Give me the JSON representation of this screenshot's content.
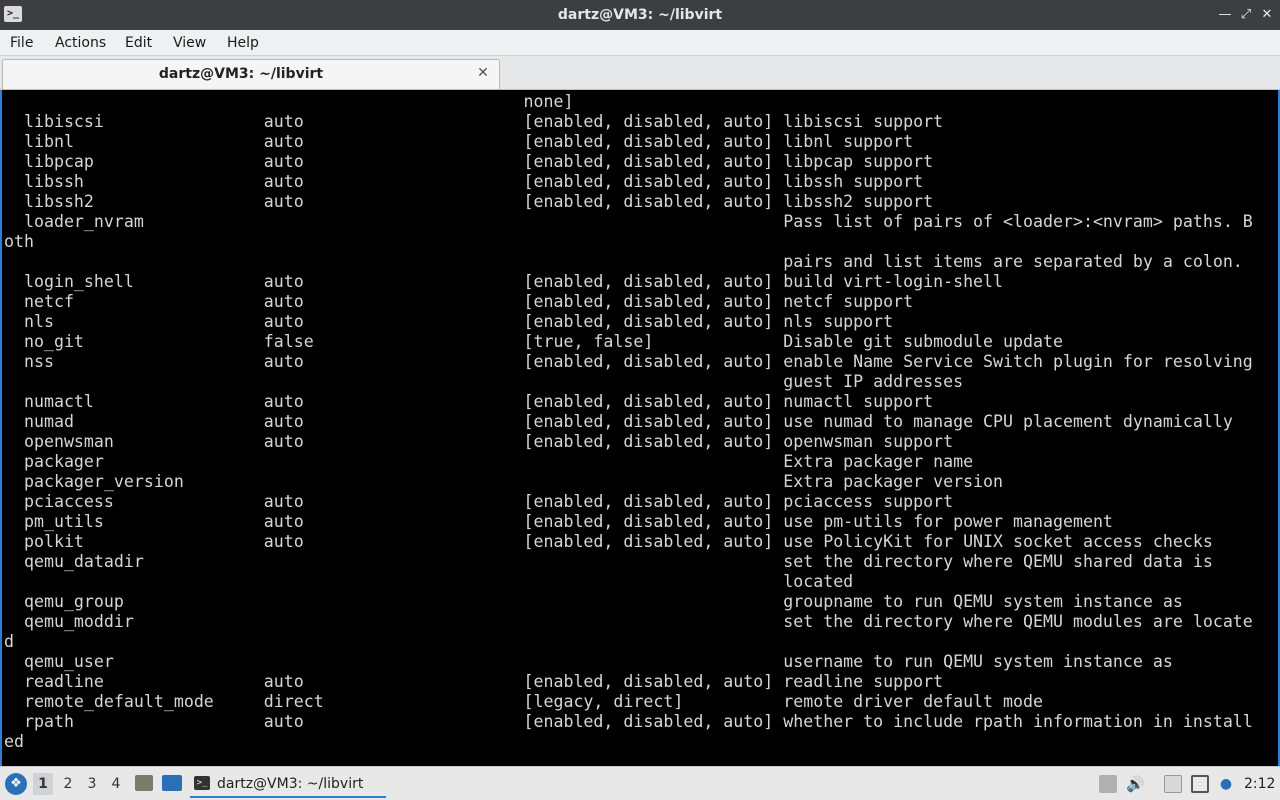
{
  "window": {
    "title": "dartz@VM3: ~/libvirt",
    "app_icon": "terminal-icon",
    "controls": {
      "minimize": "minimize-icon",
      "maximize": "maximize-icon",
      "close": "close-icon"
    }
  },
  "menubar": {
    "items": [
      "File",
      "Actions",
      "Edit",
      "View",
      "Help"
    ]
  },
  "tabs": [
    {
      "label": "dartz@VM3: ~/libvirt",
      "close_icon": "close-icon"
    }
  ],
  "terminal": {
    "lines": [
      "                                                    none]",
      "  libiscsi                auto                      [enabled, disabled, auto] libiscsi support",
      "  libnl                   auto                      [enabled, disabled, auto] libnl support",
      "  libpcap                 auto                      [enabled, disabled, auto] libpcap support",
      "  libssh                  auto                      [enabled, disabled, auto] libssh support",
      "  libssh2                 auto                      [enabled, disabled, auto] libssh2 support",
      "  loader_nvram                                                                Pass list of pairs of <loader>:<nvram> paths. B",
      "oth",
      "                                                                              pairs and list items are separated by a colon.",
      "  login_shell             auto                      [enabled, disabled, auto] build virt-login-shell",
      "  netcf                   auto                      [enabled, disabled, auto] netcf support",
      "  nls                     auto                      [enabled, disabled, auto] nls support",
      "  no_git                  false                     [true, false]             Disable git submodule update",
      "  nss                     auto                      [enabled, disabled, auto] enable Name Service Switch plugin for resolving",
      "                                                                              guest IP addresses",
      "  numactl                 auto                      [enabled, disabled, auto] numactl support",
      "  numad                   auto                      [enabled, disabled, auto] use numad to manage CPU placement dynamically",
      "  openwsman               auto                      [enabled, disabled, auto] openwsman support",
      "  packager                                                                    Extra packager name",
      "  packager_version                                                            Extra packager version",
      "  pciaccess               auto                      [enabled, disabled, auto] pciaccess support",
      "  pm_utils                auto                      [enabled, disabled, auto] use pm-utils for power management",
      "  polkit                  auto                      [enabled, disabled, auto] use PolicyKit for UNIX socket access checks",
      "  qemu_datadir                                                                set the directory where QEMU shared data is",
      "                                                                              located",
      "  qemu_group                                                                  groupname to run QEMU system instance as",
      "  qemu_moddir                                                                 set the directory where QEMU modules are locate",
      "d",
      "  qemu_user                                                                   username to run QEMU system instance as",
      "  readline                auto                      [enabled, disabled, auto] readline support",
      "  remote_default_mode     direct                    [legacy, direct]          remote driver default mode",
      "  rpath                   auto                      [enabled, disabled, auto] whether to include rpath information in install",
      "ed"
    ]
  },
  "taskbar": {
    "start_icon": "start-menu-icon",
    "workspaces": [
      "1",
      "2",
      "3",
      "4"
    ],
    "active_workspace": "1",
    "launchers": [
      "file-manager-icon",
      "show-desktop-icon"
    ],
    "task": {
      "label": "dartz@VM3: ~/libvirt",
      "icon": "terminal-icon"
    },
    "tray": [
      "update-icon",
      "volume-icon",
      "clipboard-icon",
      "network-icon",
      "user-icon"
    ],
    "clock": "2:12"
  }
}
